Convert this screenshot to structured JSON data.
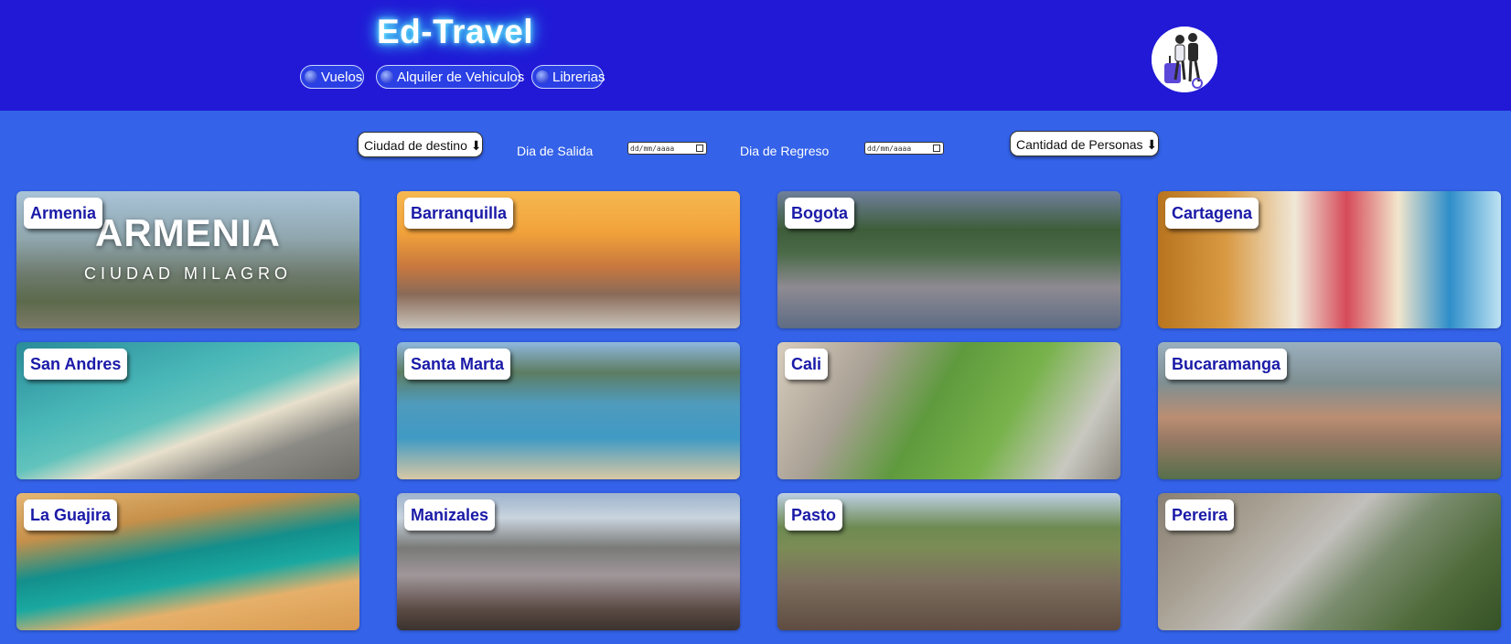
{
  "header": {
    "brand": "Ed-Travel",
    "nav": [
      {
        "label": "Vuelos",
        "icon": "plane-icon"
      },
      {
        "label": "Alquiler de Vehiculos",
        "icon": "car-icon"
      },
      {
        "label": "Librerias",
        "icon": "book-icon"
      }
    ],
    "avatar": "travelers-avatar"
  },
  "filters": {
    "destination": "Ciudad de destino ⬇",
    "departure_label": "Dia de Salida",
    "departure_value": "dd/mm/aaaa",
    "return_label": "Dia de Regreso",
    "return_value": "dd/mm/aaaa",
    "people": "Cantidad de Personas ⬇"
  },
  "cities": [
    {
      "name": "Armenia",
      "overlay_title": "ARMENIA",
      "overlay_subtitle": "CIUDAD MILAGRO"
    },
    {
      "name": "Barranquilla"
    },
    {
      "name": "Bogota"
    },
    {
      "name": "Cartagena"
    },
    {
      "name": "San Andres"
    },
    {
      "name": "Santa Marta"
    },
    {
      "name": "Cali"
    },
    {
      "name": "Bucaramanga"
    },
    {
      "name": "La Guajira"
    },
    {
      "name": "Manizales"
    },
    {
      "name": "Pasto"
    },
    {
      "name": "Pereira"
    }
  ],
  "colors": {
    "header_bg": "#2119d6",
    "page_bg": "#3462e8",
    "label_text": "#1a1aa8",
    "brand_glow": "#40f0ff"
  }
}
